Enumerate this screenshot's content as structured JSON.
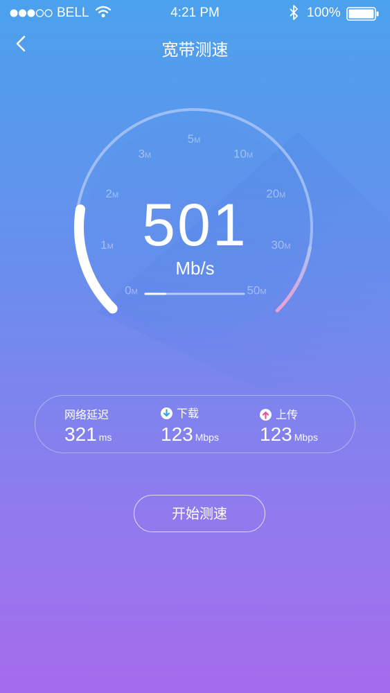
{
  "status_bar": {
    "carrier": "BELL",
    "time": "4:21 PM",
    "battery": "100%",
    "icons": [
      "signal-dots-icon",
      "wifi-icon",
      "bluetooth-icon",
      "battery-icon"
    ]
  },
  "nav": {
    "title": "宽带测速",
    "back_icon": "chevron-left-icon"
  },
  "gauge": {
    "ticks": [
      {
        "num": "0",
        "unit": "M"
      },
      {
        "num": "1",
        "unit": "M"
      },
      {
        "num": "2",
        "unit": "M"
      },
      {
        "num": "3",
        "unit": "M"
      },
      {
        "num": "5",
        "unit": "M"
      },
      {
        "num": "10",
        "unit": "M"
      },
      {
        "num": "20",
        "unit": "M"
      },
      {
        "num": "30",
        "unit": "M"
      },
      {
        "num": "50",
        "unit": "M"
      }
    ],
    "value": "501",
    "unit": "Mb/s",
    "progress_fraction": 0.2,
    "colors": {
      "track": "#a9c4f6",
      "active": "#ffffff",
      "end_highlight": "#e9a7d6"
    }
  },
  "stats": {
    "latency": {
      "label": "网络延迟",
      "value": "321",
      "unit": "ms"
    },
    "download": {
      "label": "下载",
      "value": "123",
      "unit": "Mbps",
      "icon": "download-arrow-icon",
      "icon_color": "#3aa3e2"
    },
    "upload": {
      "label": "上传",
      "value": "123",
      "unit": "Mbps",
      "icon": "upload-arrow-icon",
      "icon_color": "#e9509a"
    }
  },
  "start_button": {
    "label": "开始测速"
  },
  "colors": {
    "background_top": "#4ba1ec",
    "background_bottom": "#a56bec"
  }
}
